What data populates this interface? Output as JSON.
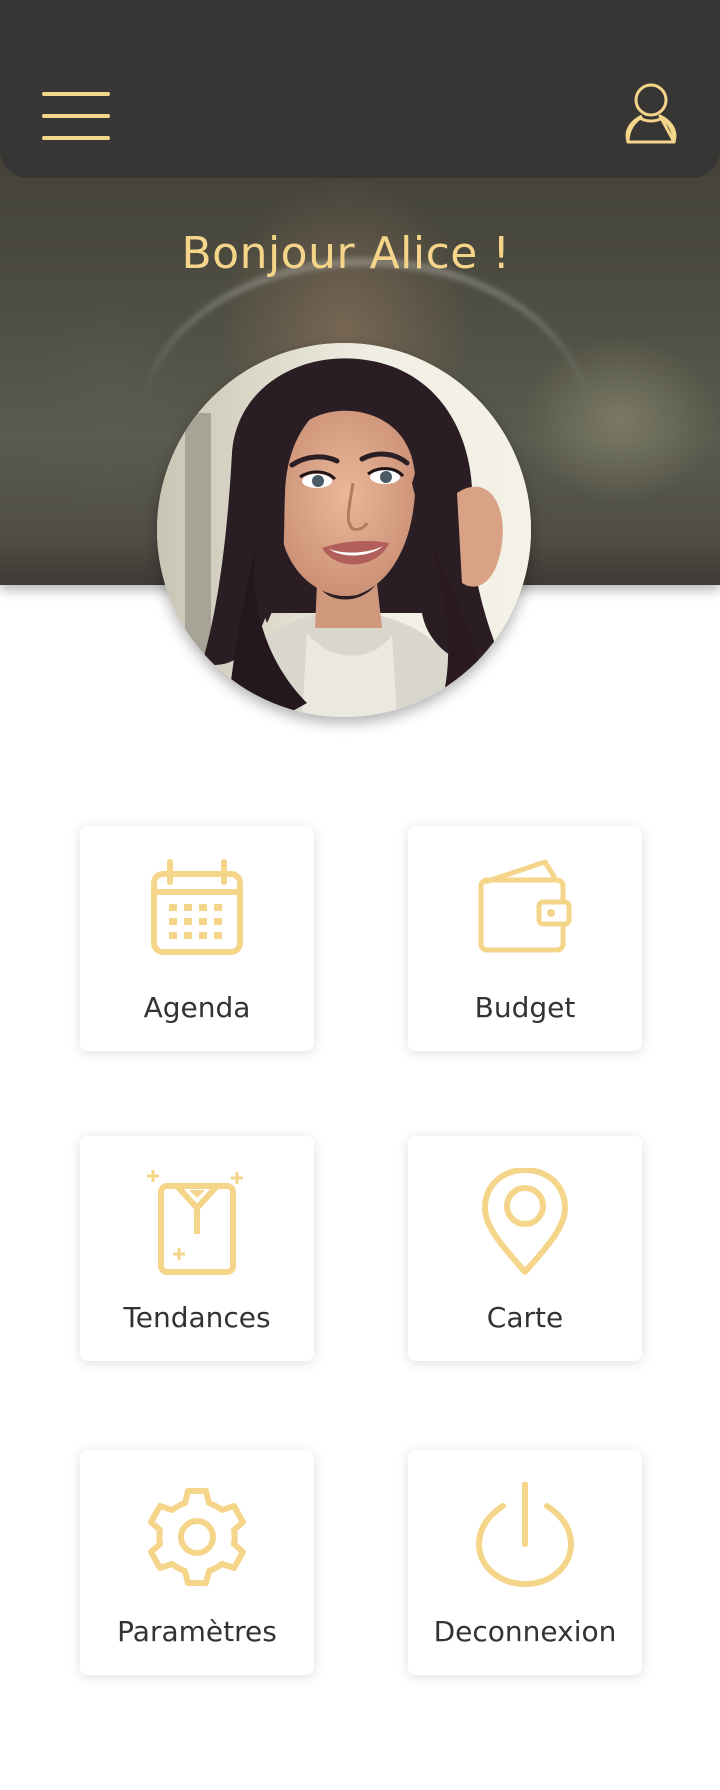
{
  "header": {
    "menu_icon": "hamburger-menu-icon",
    "profile_icon": "user-profile-icon"
  },
  "hero": {
    "greeting": "Bonjour Alice !"
  },
  "colors": {
    "accent": "#f5d58a",
    "header_bg": "#383634",
    "card_text": "#333333",
    "page_bg": "#ffffff"
  },
  "tiles": [
    {
      "label": "Agenda",
      "icon": "calendar-icon"
    },
    {
      "label": "Budget",
      "icon": "wallet-icon"
    },
    {
      "label": "Tendances",
      "icon": "shirt-trends-icon"
    },
    {
      "label": "Carte",
      "icon": "map-pin-icon"
    },
    {
      "label": "Paramètres",
      "icon": "gear-icon"
    },
    {
      "label": "Deconnexion",
      "icon": "power-icon"
    }
  ]
}
